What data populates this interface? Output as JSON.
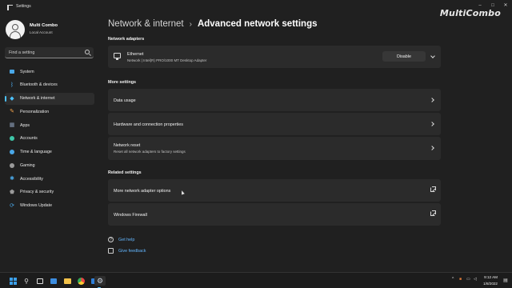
{
  "window": {
    "title": "Settings",
    "watermark": "MultiCombo"
  },
  "user": {
    "name": "Multi Combo",
    "account": "Local Account"
  },
  "search": {
    "placeholder": "Find a setting"
  },
  "sidebar": {
    "items": [
      {
        "label": "System",
        "icon": "monitor-icon",
        "color": "#4aa8e8"
      },
      {
        "label": "Bluetooth & devices",
        "icon": "bluetooth-icon",
        "color": "#4aa8e8"
      },
      {
        "label": "Network & internet",
        "icon": "wifi-icon",
        "color": "#4cc2ff",
        "active": true
      },
      {
        "label": "Personalization",
        "icon": "brush-icon",
        "color": "#f0a04a"
      },
      {
        "label": "Apps",
        "icon": "apps-icon",
        "color": "#8a9bb5"
      },
      {
        "label": "Accounts",
        "icon": "person-icon",
        "color": "#3ec6a8"
      },
      {
        "label": "Time & language",
        "icon": "globe-icon",
        "color": "#4aa8e8"
      },
      {
        "label": "Gaming",
        "icon": "gamepad-icon",
        "color": "#9a9a9a"
      },
      {
        "label": "Accessibility",
        "icon": "accessibility-icon",
        "color": "#4aa8e8"
      },
      {
        "label": "Privacy & security",
        "icon": "shield-icon",
        "color": "#9a9a9a"
      },
      {
        "label": "Windows Update",
        "icon": "update-icon",
        "color": "#4aa8e8"
      }
    ]
  },
  "breadcrumb": {
    "parent": "Network & internet",
    "separator": "›",
    "current": "Advanced network settings"
  },
  "sections": {
    "adapters": "Network adapters",
    "more": "More settings",
    "related": "Related settings"
  },
  "adapter": {
    "name": "Ethernet",
    "description": "Network | Intel(R) PRO/1000 MT Desktop Adapter",
    "action": "Disable"
  },
  "more_settings": [
    {
      "title": "Data usage"
    },
    {
      "title": "Hardware and connection properties"
    },
    {
      "title": "Network reset",
      "subtitle": "Reset all network adapters to factory settings"
    }
  ],
  "related_settings": [
    {
      "title": "More network adapter options"
    },
    {
      "title": "Windows Firewall"
    }
  ],
  "help": {
    "get_help": "Get help",
    "give_feedback": "Give feedback"
  },
  "taskbar": {
    "time": "9:12 AM",
    "date": "1/8/2022"
  },
  "colors": {
    "accent": "#4cc2ff",
    "link": "#63b7ff",
    "card": "#2b2b2b",
    "background": "#202020"
  }
}
